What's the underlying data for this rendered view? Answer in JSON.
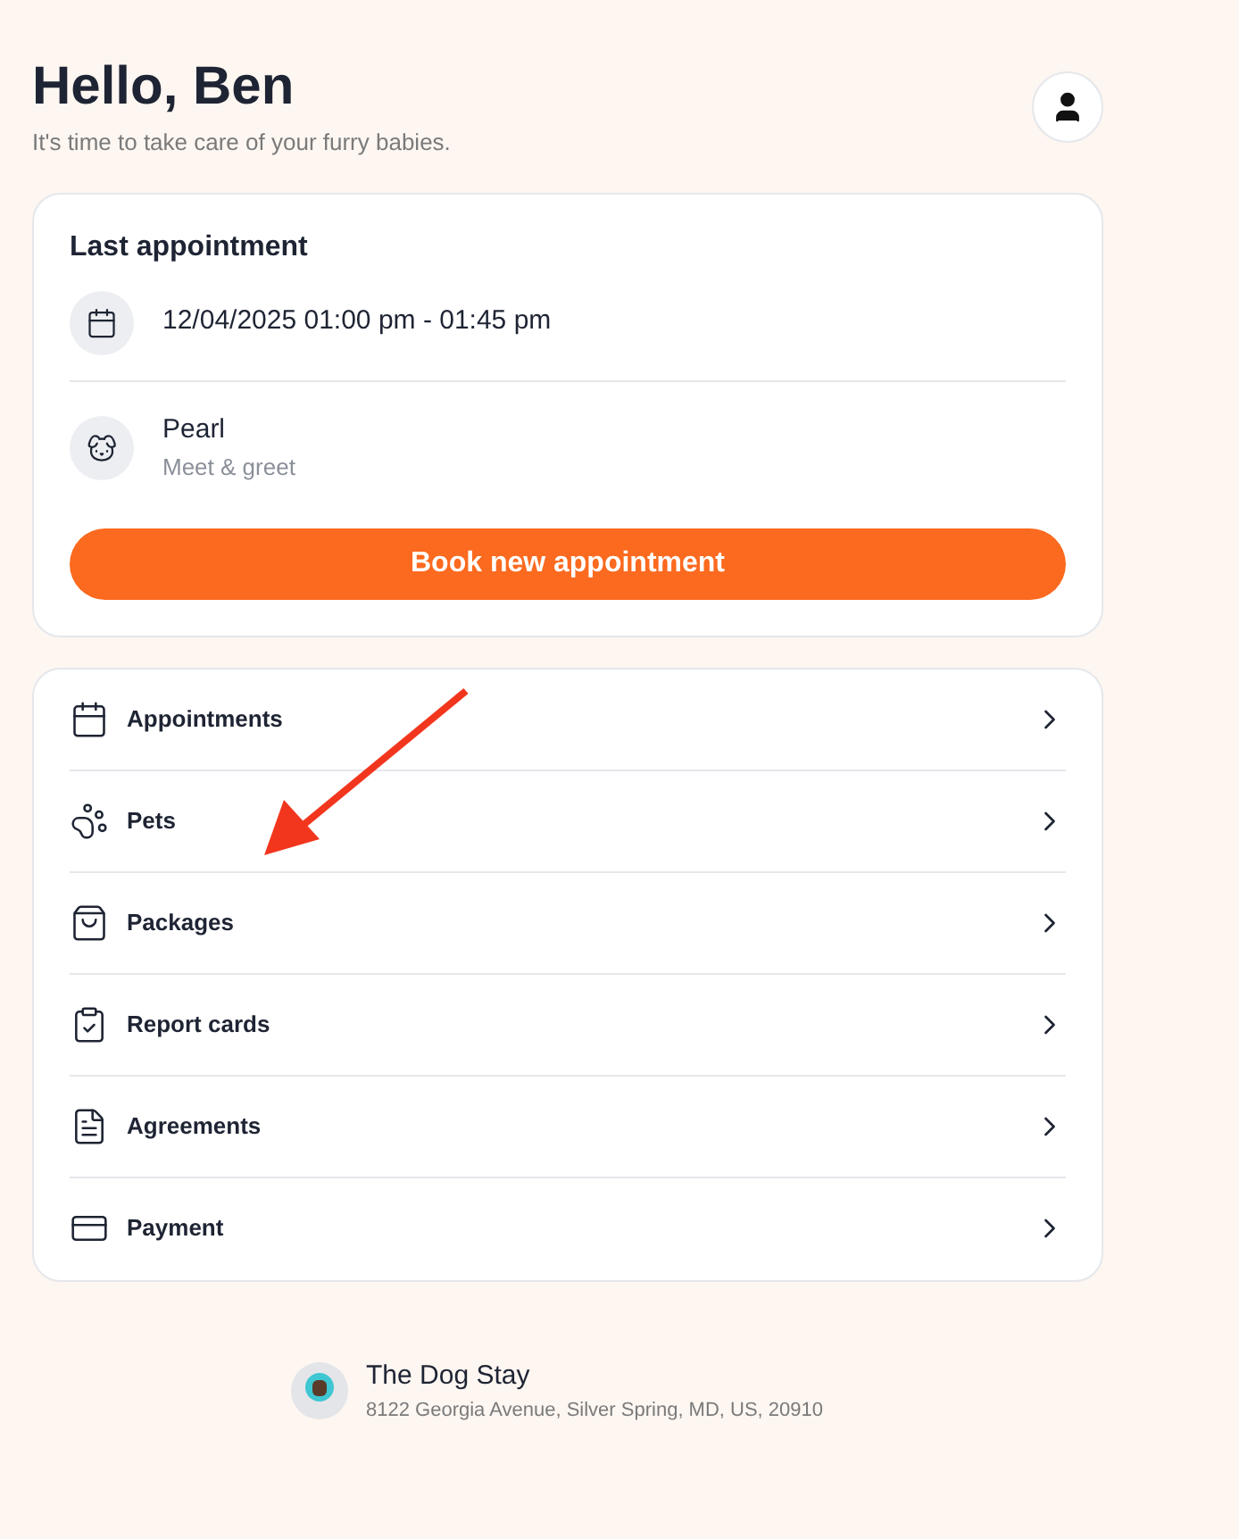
{
  "header": {
    "title": "Hello, Ben",
    "subtitle": "It's time to take care of your furry babies."
  },
  "last_appointment": {
    "title": "Last appointment",
    "datetime": "12/04/2025 01:00 pm - 01:45 pm",
    "pet_name": "Pearl",
    "service": "Meet & greet",
    "button": "Book new appointment"
  },
  "menu": [
    {
      "kind": "calendar",
      "label": "Appointments"
    },
    {
      "kind": "paw",
      "label": "Pets"
    },
    {
      "kind": "bag",
      "label": "Packages"
    },
    {
      "kind": "report",
      "label": "Report cards"
    },
    {
      "kind": "document",
      "label": "Agreements"
    },
    {
      "kind": "card",
      "label": "Payment"
    }
  ],
  "footer": {
    "business": "The Dog Stay",
    "address": "8122 Georgia Avenue, Silver Spring, MD, US, 20910"
  }
}
